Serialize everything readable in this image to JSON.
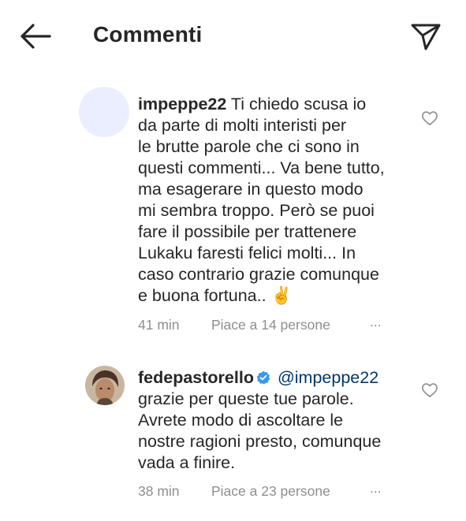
{
  "header": {
    "title": "Commenti"
  },
  "comments": [
    {
      "username": "impeppe22",
      "text_lines": [
        " Ti chiedo scusa io",
        "da parte di molti interisti per",
        "le brutte parole che ci sono in",
        "questi commenti... Va bene tutto,",
        "ma esagerare in questo modo",
        "mi sembra troppo. Però se puoi",
        "fare il possibile per trattenere",
        "Lukaku faresti felici molti... In",
        "caso contrario grazie comunque",
        "e buona fortuna.. ✌️"
      ],
      "time": "41 min",
      "likes": "Piace a 14 persone",
      "more": "..."
    },
    {
      "username": "fedepastorello",
      "mention": "@impeppe22",
      "text_lines": [
        "grazie per queste tue parole.",
        "Avrete modo di ascoltare le",
        "nostre ragioni presto, comunque",
        "vada a finire."
      ],
      "time": "38 min",
      "likes": "Piace a 23 persone",
      "more": "..."
    }
  ],
  "icons": {
    "back": "arrow-left-icon",
    "send": "paper-plane-icon",
    "like": "heart-icon",
    "verified": "verified-badge-icon"
  },
  "colors": {
    "text": "#262626",
    "meta": "#8e8e8e",
    "verified": "#3897f0",
    "mention": "#00376b"
  }
}
